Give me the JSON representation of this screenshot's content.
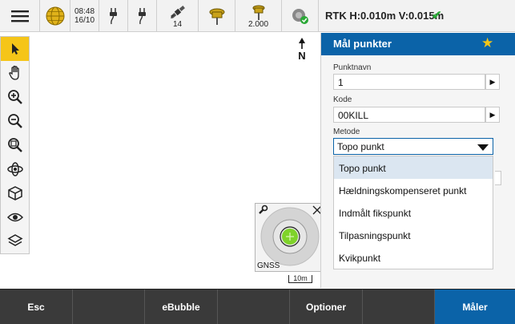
{
  "status_bar": {
    "time": "08:48",
    "date": "16/10",
    "satellites": "14",
    "antenna_height": "2.000",
    "rtk_precision": "RTK H:0.010m V:0.015m"
  },
  "map": {
    "north_label": "N",
    "bubble_label": "GNSS",
    "scale_label": "10m"
  },
  "panel": {
    "title": "Mål punkter",
    "point_name": {
      "label": "Punktnavn",
      "value": "1"
    },
    "code": {
      "label": "Kode",
      "value": "00KILL"
    },
    "method": {
      "label": "Metode",
      "value": "Topo punkt",
      "options": [
        "Topo punkt",
        "Hældningskompenseret punkt",
        "Indmålt fikspunkt",
        "Tilpasningspunkt",
        "Kvikpunkt"
      ]
    }
  },
  "bottom_bar": {
    "esc": "Esc",
    "ebubble": "eBubble",
    "options": "Optioner",
    "measure": "Måler"
  },
  "colors": {
    "accent": "#0b63a8",
    "active_tool": "#f5c518",
    "ok_check": "#2aa836",
    "bubble_green": "#7fd32a"
  }
}
